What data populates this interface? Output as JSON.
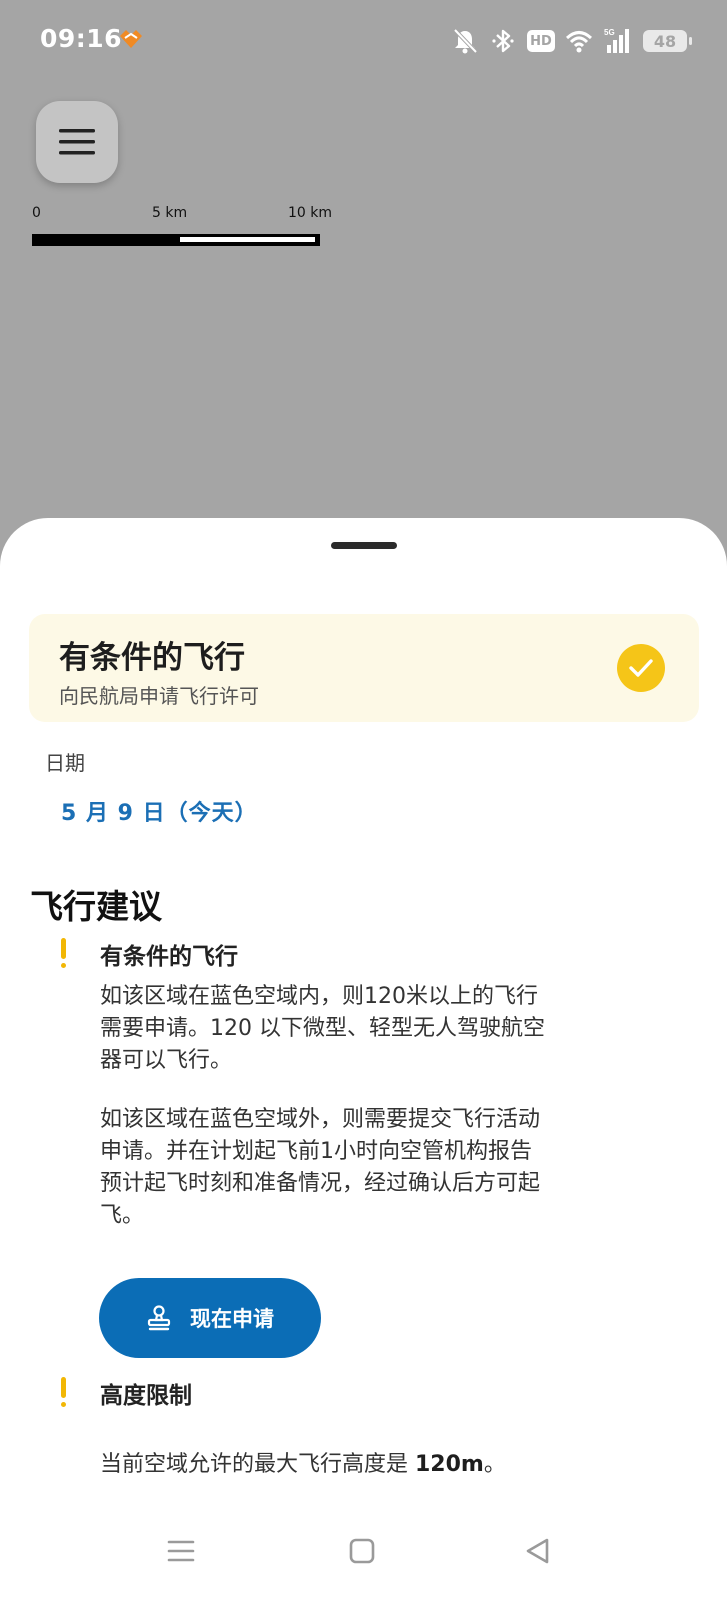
{
  "status_bar": {
    "time": "09:16",
    "hd_label": "HD",
    "network_label": "5G",
    "battery_level": "48"
  },
  "map": {
    "menu_icon": "hamburger-menu-icon",
    "scale": {
      "labels": [
        "0",
        "5 km",
        "10 km"
      ]
    }
  },
  "sheet": {
    "status_card": {
      "title": "有条件的飞行",
      "subtitle": "向民航局申请飞行许可",
      "icon": "check-circle-icon",
      "accent": "#f5c518"
    },
    "date": {
      "label": "日期",
      "value": "5 月 9 日（今天）"
    },
    "advice": {
      "heading": "飞行建议",
      "items": [
        {
          "icon": "warning-icon",
          "title": "有条件的飞行",
          "paragraphs": [
            "如该区域在蓝色空域内，则120米以上的飞行需要申请。120 以下微型、轻型无人驾驶航空器可以飞行。",
            "如该区域在蓝色空域外，则需要提交飞行活动申请。并在计划起飞前1小时向空管机构报告预计起飞时刻和准备情况，经过确认后方可起飞。"
          ],
          "button_label": "现在申请",
          "button_icon": "stamp-icon"
        },
        {
          "icon": "warning-icon",
          "title": "高度限制",
          "text_prefix": "当前空域允许的最大飞行高度是 ",
          "text_value": "120m",
          "text_suffix": "。"
        }
      ]
    }
  },
  "colors": {
    "map_bg": "#a5a5a5",
    "primary": "#0b6db6",
    "date_link": "#1b6fb5",
    "warning": "#f2b705",
    "card_bg": "#fdf9e6"
  }
}
